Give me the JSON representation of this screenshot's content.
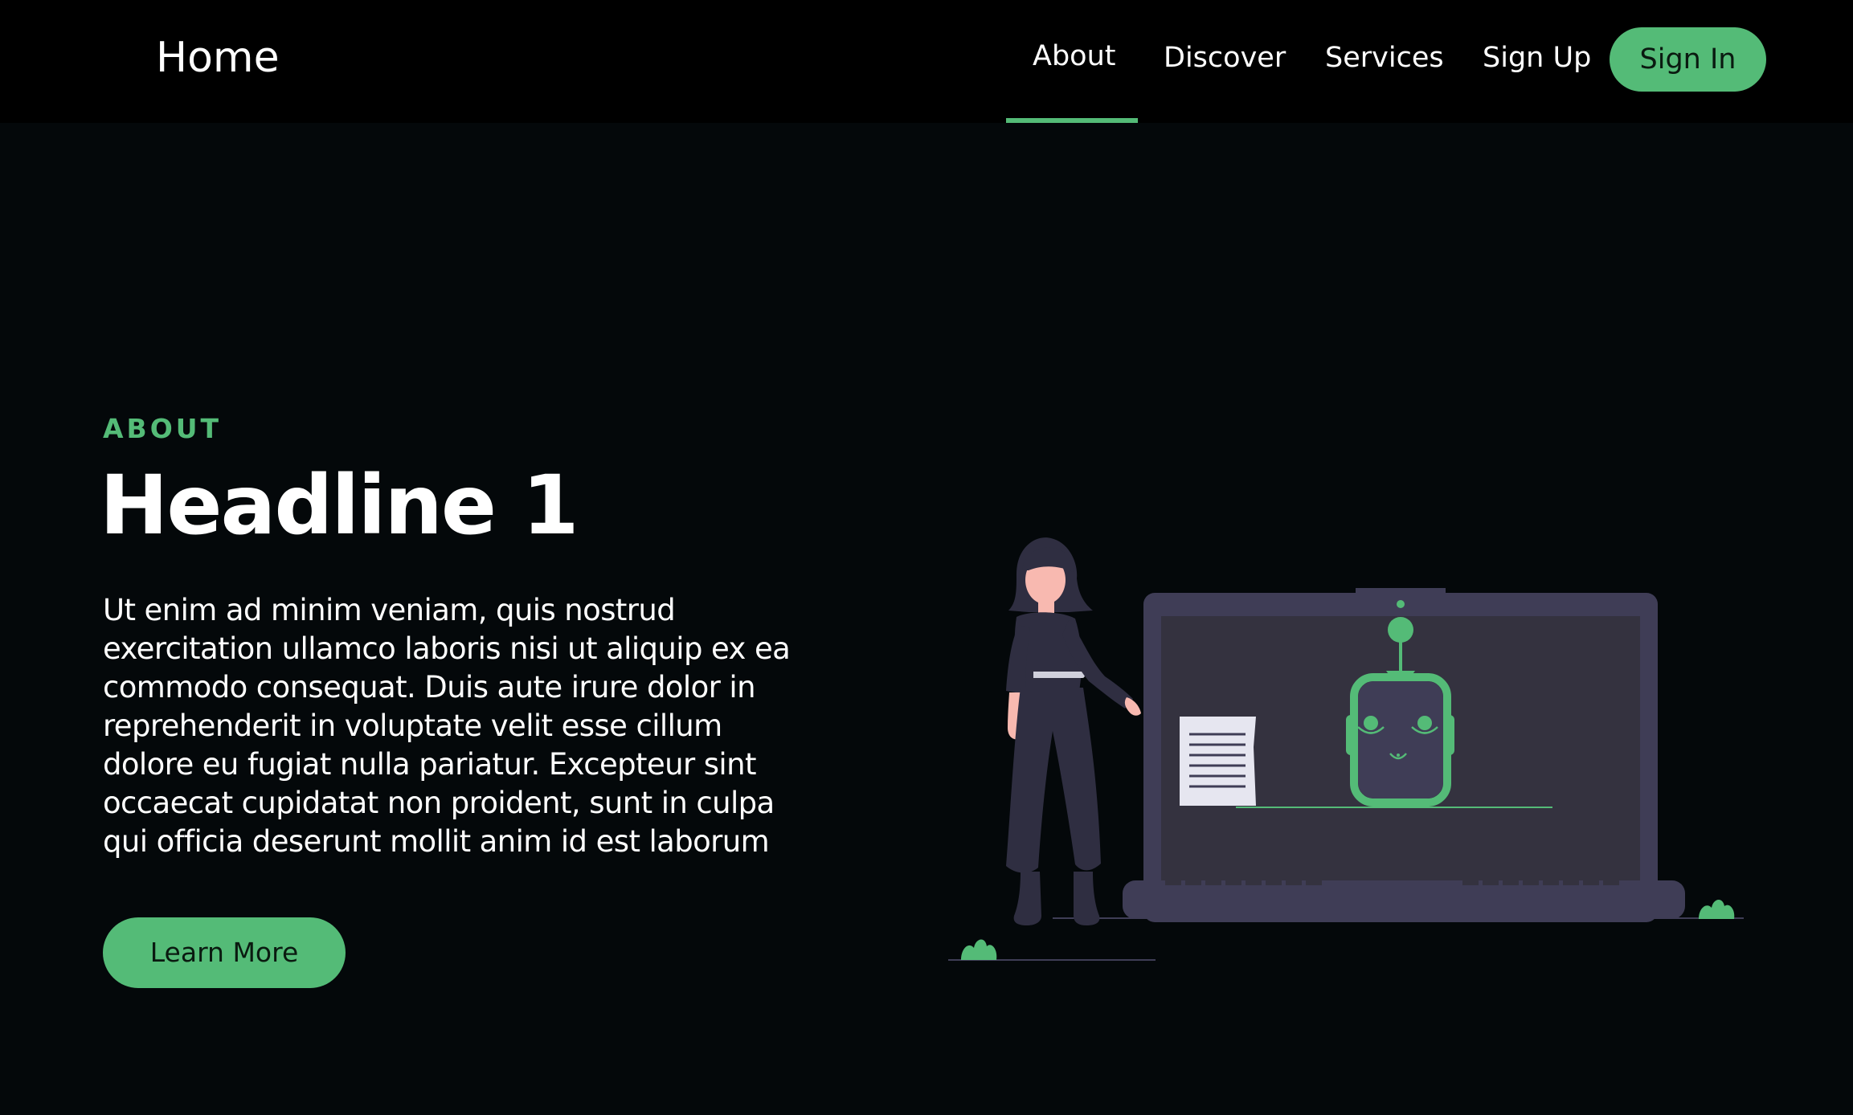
{
  "nav": {
    "brand": "Home",
    "links": [
      {
        "label": "About",
        "active": true
      },
      {
        "label": "Discover"
      },
      {
        "label": "Services"
      },
      {
        "label": "Sign Up"
      }
    ],
    "signin_label": "Sign In"
  },
  "hero": {
    "eyebrow": "ABOUT",
    "headline": "Headline 1",
    "body": "Ut enim ad minim veniam, quis nostrud exercitation ullamco laboris nisi ut aliquip ex ea commodo consequat. Duis aute irure dolor in reprehenderit in voluptate velit esse cillum dolore eu fugiat nulla pariatur. Excepteur sint occaecat cupidatat non proident, sunt in culpa qui officia deserunt mollit anim id est laborum",
    "cta_label": "Learn More"
  },
  "illustration": {
    "icon": "woman-presenting-robot-on-laptop-illustration"
  },
  "colors": {
    "accent": "#54bb77",
    "background": "#04080a",
    "navbar": "#000000",
    "laptop": "#3f3d56",
    "screen": "#34323f",
    "text": "#ffffff"
  }
}
